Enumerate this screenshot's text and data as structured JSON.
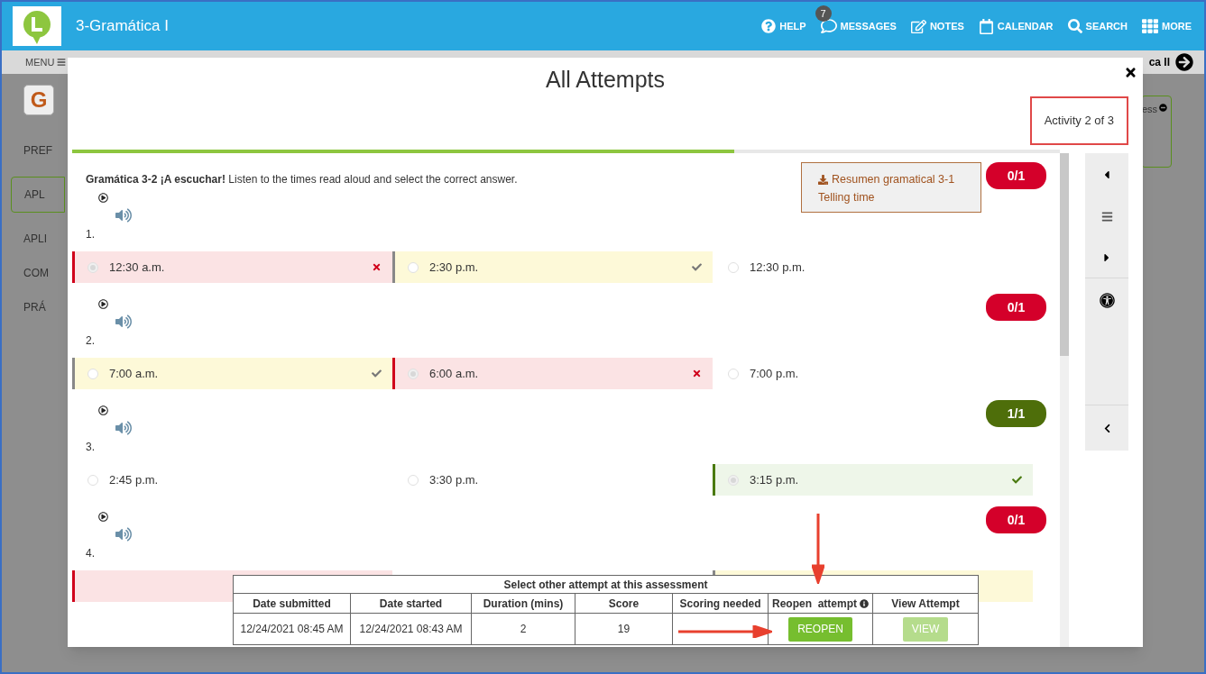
{
  "header": {
    "title": "3-Gramática I",
    "nav": [
      {
        "kind": "help",
        "label": "HELP"
      },
      {
        "kind": "messages",
        "label": "MESSAGES",
        "badge": "7"
      },
      {
        "kind": "notes",
        "label": "NOTES"
      },
      {
        "kind": "calendar",
        "label": "CALENDAR"
      },
      {
        "kind": "search",
        "label": "SEARCH"
      },
      {
        "kind": "more",
        "label": "MORE"
      }
    ]
  },
  "background": {
    "menu": "MENU",
    "tile": "G",
    "next_link": "ca II",
    "side_items": [
      {
        "label": "PREF",
        "selected": false
      },
      {
        "label": "APL",
        "selected": true
      },
      {
        "label": "APLI",
        "selected": false
      },
      {
        "label": "COM",
        "selected": false
      },
      {
        "label": "PRÁ",
        "selected": false
      }
    ],
    "right_card": "ess"
  },
  "modal": {
    "title": "All Attempts",
    "activity": "Activity 2 of 3",
    "progress": {
      "level": 0.67
    },
    "instructions": "**Gramática 3-2 ¡A escuchar!** Listen to the times read aloud and select the correct answer.",
    "resource": {
      "line1": "Resumen gramatical 3-1",
      "line2": "Telling time"
    },
    "questions": [
      {
        "number": "1.",
        "score": "0/1",
        "correct": false,
        "options": [
          {
            "text": "12:30 a.m.",
            "kind": "wrong",
            "selected": true
          },
          {
            "text": "2:30 p.m.",
            "kind": "key",
            "selected": false
          },
          {
            "text": "12:30 p.m.",
            "kind": "plain",
            "selected": false
          }
        ]
      },
      {
        "number": "2.",
        "score": "0/1",
        "correct": false,
        "options": [
          {
            "text": "7:00 a.m.",
            "kind": "key",
            "selected": false
          },
          {
            "text": "6:00 a.m.",
            "kind": "wrong",
            "selected": true
          },
          {
            "text": "7:00 p.m.",
            "kind": "plain",
            "selected": false
          }
        ]
      },
      {
        "number": "3.",
        "score": "1/1",
        "correct": true,
        "options": [
          {
            "text": "2:45 p.m.",
            "kind": "plain",
            "selected": false
          },
          {
            "text": "3:30 p.m.",
            "kind": "plain",
            "selected": false
          },
          {
            "text": "3:15 p.m.",
            "kind": "correct",
            "selected": true
          }
        ]
      },
      {
        "number": "4.",
        "score": "0/1",
        "correct": false,
        "options": [
          {
            "kind": "wrong"
          },
          {
            "kind": "plain"
          },
          {
            "kind": "key"
          }
        ]
      }
    ],
    "attempts": {
      "caption": "Select other attempt at this assessment",
      "columns": [
        "Date submitted",
        "Date started",
        "Duration (mins)",
        "Score",
        "Scoring needed",
        "Reopen  attempt",
        "View Attempt"
      ],
      "rows": [
        {
          "cells": [
            "12/24/2021 08:45 AM",
            "12/24/2021 08:43 AM",
            "2",
            "19"
          ],
          "reopen": {
            "label": "REOPEN",
            "disabled": false
          },
          "view": {
            "label": "VIEW",
            "disabled": true
          }
        }
      ]
    }
  }
}
